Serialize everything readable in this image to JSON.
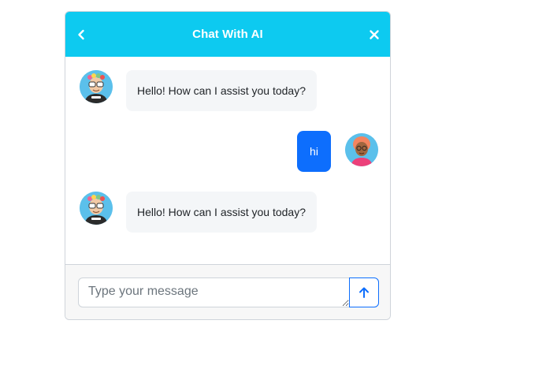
{
  "header": {
    "title": "Chat With AI",
    "back_icon": "chevron-left-icon",
    "close_icon": "close-icon"
  },
  "messages": [
    {
      "sender": "bot",
      "text": "Hello! How can I assist you today?"
    },
    {
      "sender": "user",
      "text": "hi"
    },
    {
      "sender": "bot",
      "text": "Hello! How can I assist you today?"
    }
  ],
  "composer": {
    "value": "",
    "placeholder": "Type your message",
    "send_icon": "arrow-up-icon"
  },
  "colors": {
    "header_bg": "#0dcaf0",
    "user_bubble": "#0d6efd",
    "bot_bubble": "#f4f6f8",
    "avatar_bg": "#5bc0eb"
  }
}
